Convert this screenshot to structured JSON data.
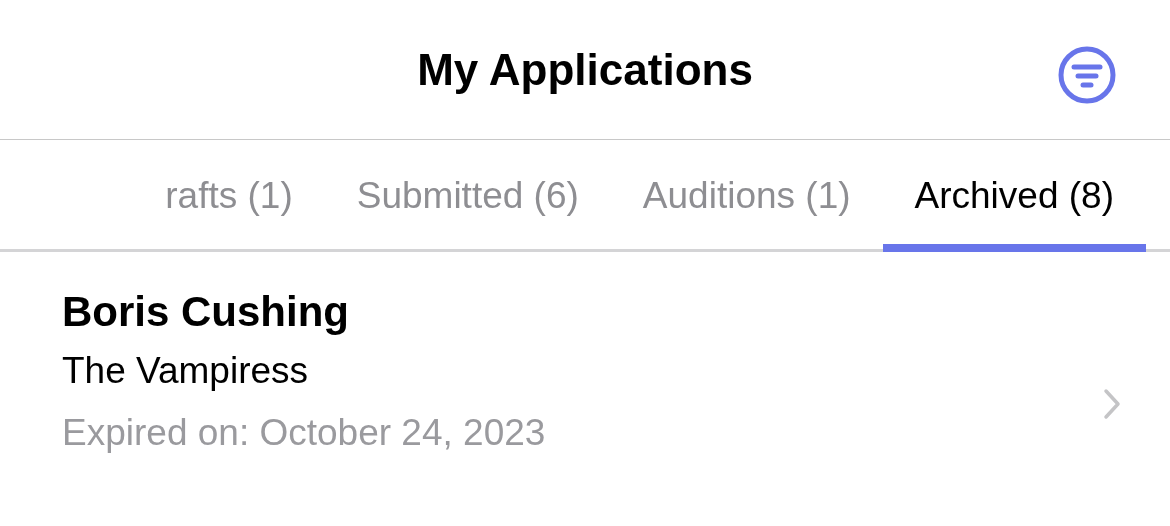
{
  "header": {
    "title": "My Applications"
  },
  "tabs": [
    {
      "label": "rafts (1)",
      "selected": false
    },
    {
      "label": "Submitted (6)",
      "selected": false
    },
    {
      "label": "Auditions (1)",
      "selected": false
    },
    {
      "label": "Archived (8)",
      "selected": true
    }
  ],
  "applications": [
    {
      "name": "Boris Cushing",
      "production": "The Vampiress",
      "status": "Expired on: October 24, 2023"
    }
  ]
}
